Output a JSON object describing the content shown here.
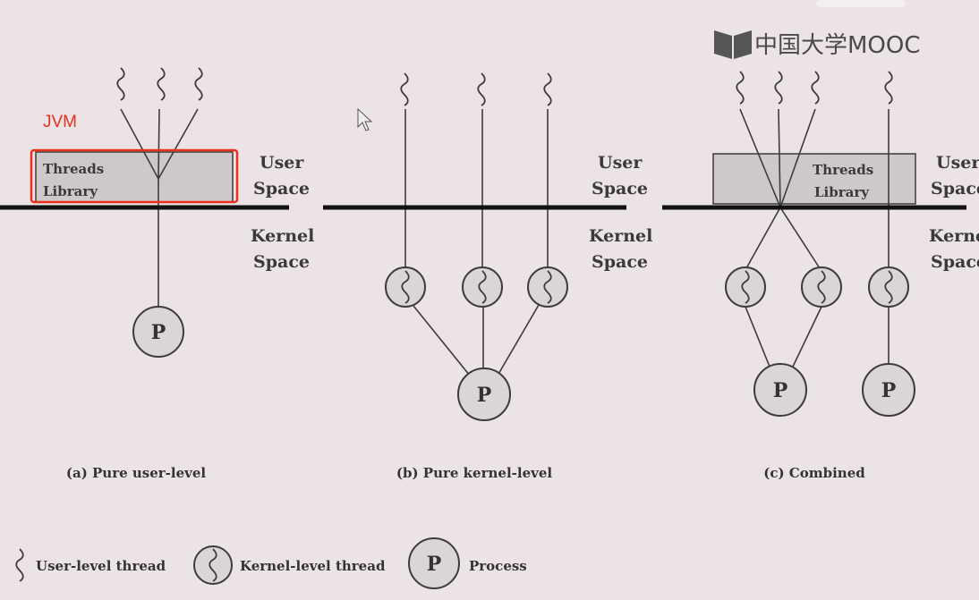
{
  "logo": {
    "text": "中国大学MOOC"
  },
  "annotation": {
    "jvm_label": "JVM",
    "highlight_color": "#e8301c"
  },
  "labels": {
    "user": "User",
    "space": "Space",
    "kernel": "Kernel",
    "threads": "Threads",
    "library": "Library",
    "process_letter": "P"
  },
  "captions": {
    "a": "(a) Pure user-level",
    "b": "(b) Pure kernel-level",
    "c": "(c) Combined"
  },
  "legend": {
    "user_thread": "User-level thread",
    "kernel_thread": "Kernel-level thread",
    "process": "Process"
  },
  "icons": [
    "cursor-icon",
    "mooc-logo-icon",
    "squiggle-icon",
    "kernel-thread-icon",
    "process-icon"
  ]
}
